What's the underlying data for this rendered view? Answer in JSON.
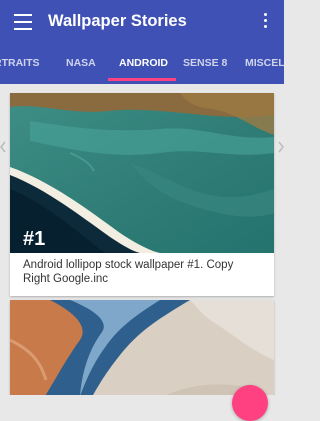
{
  "app": {
    "title": "Wallpaper Stories"
  },
  "tabs": [
    {
      "label": "RTRAITS",
      "active": false
    },
    {
      "label": "NASA",
      "active": false
    },
    {
      "label": "ANDROID",
      "active": true
    },
    {
      "label": "SENSE 8",
      "active": false
    },
    {
      "label": "MISCEL",
      "active": false
    }
  ],
  "cards": [
    {
      "number": "#1",
      "caption": "Android lollipop stock wallpaper #1. Copy Right Google.inc"
    }
  ],
  "colors": {
    "primary": "#3f51b5",
    "accent": "#ff4081",
    "background": "#e8e8e8"
  },
  "icons": {
    "menu": "menu-icon",
    "overflow": "more-vert-icon"
  }
}
